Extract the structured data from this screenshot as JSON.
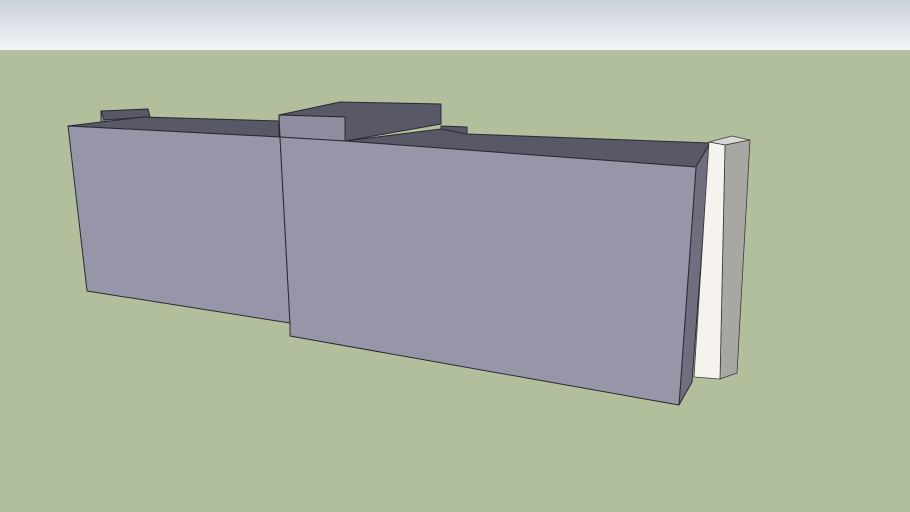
{
  "scene": {
    "sky_top_color": "#c8d0d8",
    "sky_bottom_color": "#f4f6f8",
    "ground_color": "#b1bf9c",
    "building_front_color": "#9796a8",
    "building_front_shade_color": "#8f8ea0",
    "building_roof_color": "#585866",
    "building_side_color": "#6f6e7e",
    "pillar_front_color": "#f6f3ee",
    "pillar_side_color": "#a8a7a2",
    "pillar_top_color": "#d8d8d4",
    "edge_color": "#2a2a33"
  }
}
